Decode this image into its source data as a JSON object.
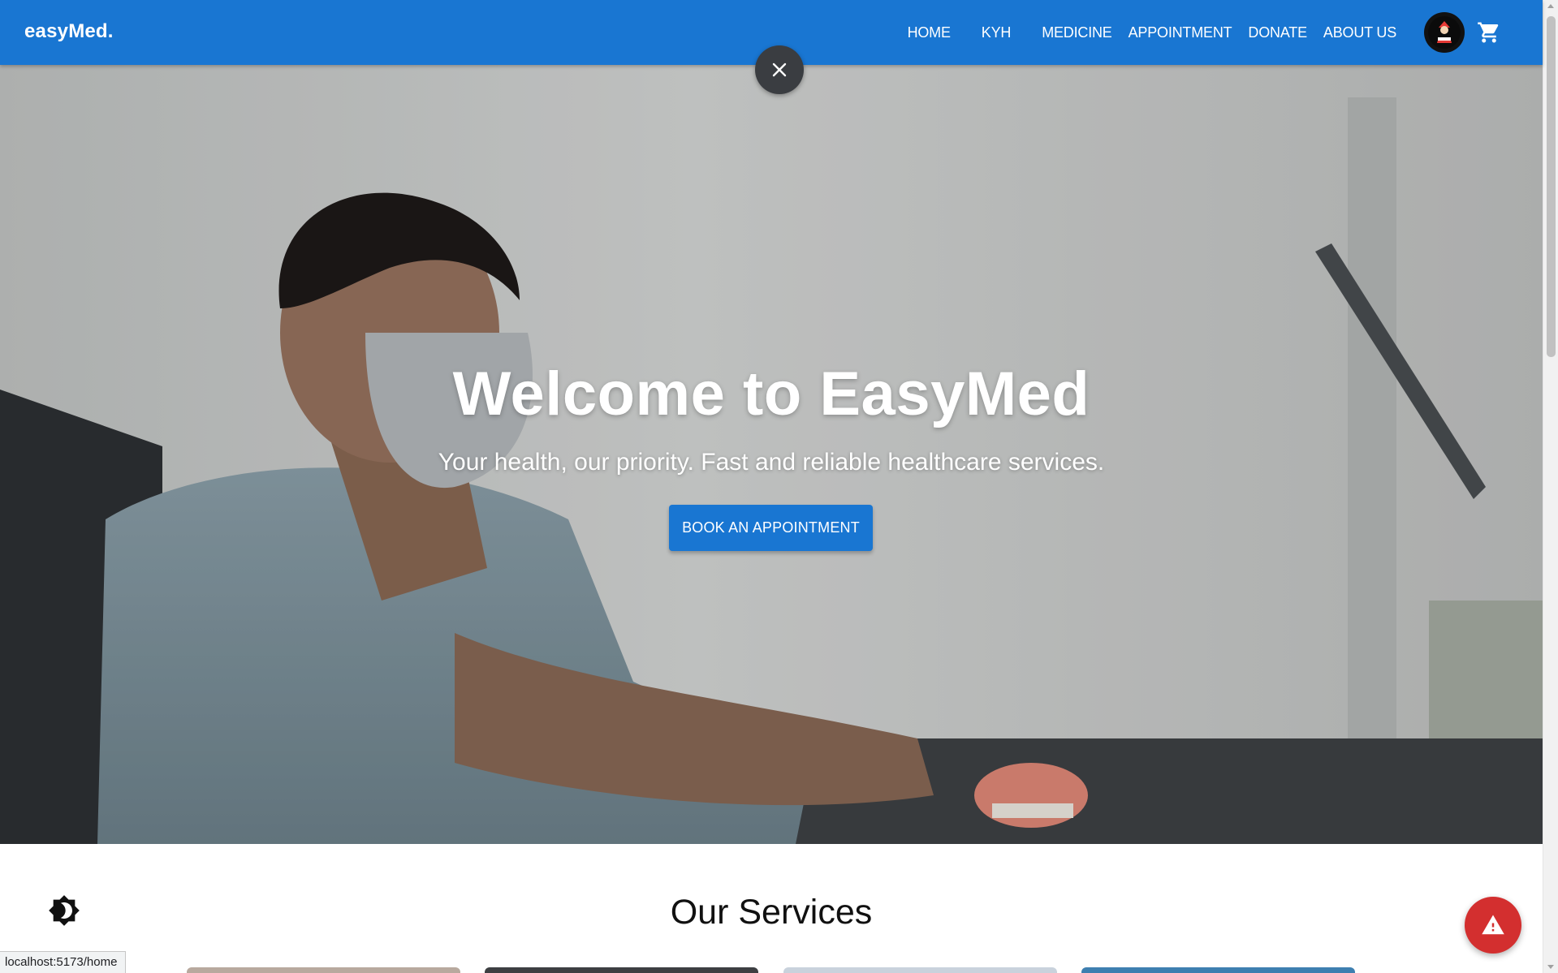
{
  "app": {
    "brand": "easyMed."
  },
  "nav": {
    "items": [
      "HOME",
      "KYH",
      "MEDICINE",
      "APPOINTMENT",
      "DONATE",
      "ABOUT US"
    ],
    "avatar_icon": "user-avatar",
    "cart_icon": "shopping-cart-icon"
  },
  "overlay": {
    "close_icon": "close-icon"
  },
  "hero": {
    "title": "Welcome to EasyMed",
    "subtitle": "Your health, our priority. Fast and reliable healthcare services.",
    "cta_label": "BOOK AN APPOINTMENT"
  },
  "services": {
    "title": "Our Services"
  },
  "floating": {
    "theme_icon": "brightness-icon",
    "alert_icon": "warning-icon"
  },
  "status_bar": {
    "url": "localhost:5173/home"
  },
  "colors": {
    "primary": "#1976d2",
    "alert": "#d32f2f",
    "close_button": "#3a3d41"
  }
}
